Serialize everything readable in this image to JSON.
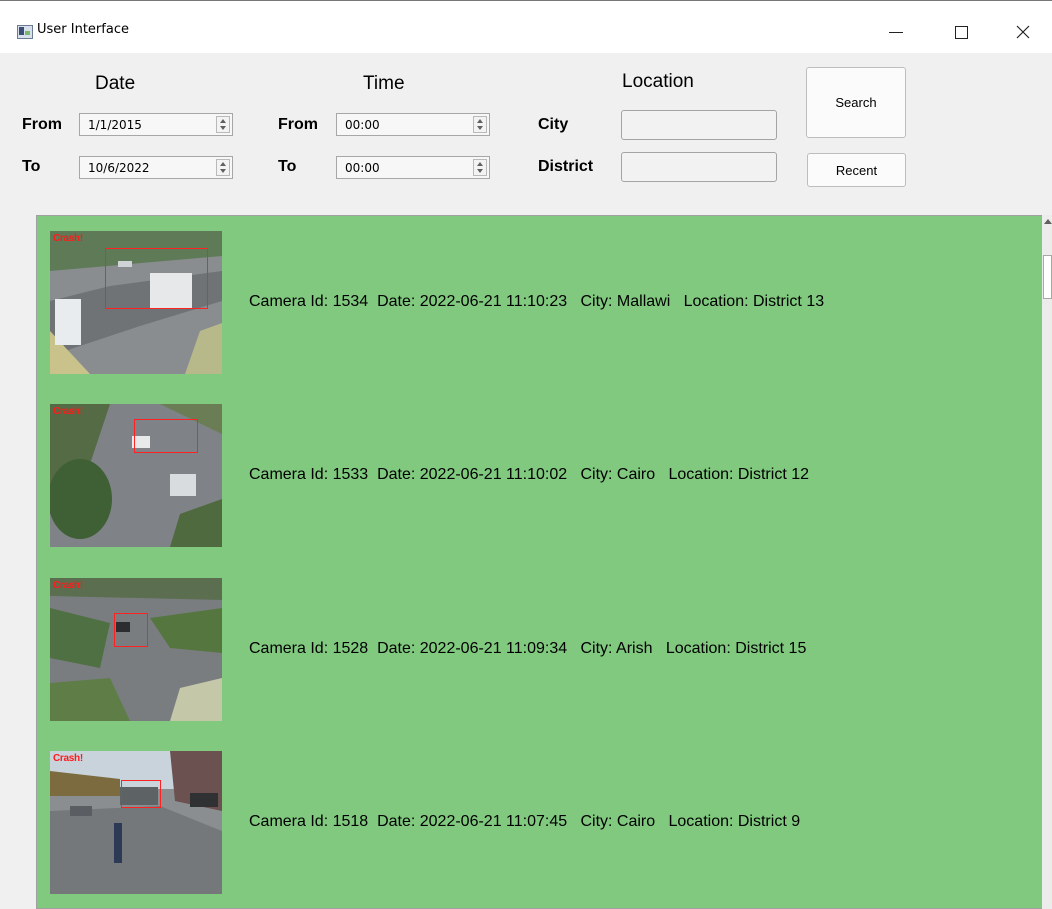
{
  "window": {
    "title": "User Interface",
    "icon": "app-window-icon"
  },
  "filters": {
    "date": {
      "header": "Date",
      "from_label": "From",
      "from_value": "1/1/2015",
      "to_label": "To",
      "to_value": "10/6/2022"
    },
    "time": {
      "header": "Time",
      "from_label": "From",
      "from_value": "00:00",
      "to_label": "To",
      "to_value": "00:00"
    },
    "location": {
      "header": "Location",
      "city_label": "City",
      "city_value": "",
      "district_label": "District",
      "district_value": ""
    },
    "search_label": "Search",
    "recent_label": "Recent"
  },
  "results": [
    {
      "camera_id": "1534",
      "date": "2022-06-21 11:10:23",
      "city": "Mallawi",
      "district": "District 13",
      "text": "Camera Id: 1534  Date: 2022-06-21 11:10:23   City: Mallawi   Location: District 13",
      "overlay": "Crash!"
    },
    {
      "camera_id": "1533",
      "date": "2022-06-21 11:10:02",
      "city": "Cairo",
      "district": "District 12",
      "text": "Camera Id: 1533  Date: 2022-06-21 11:10:02   City: Cairo   Location: District 12",
      "overlay": "Crash!"
    },
    {
      "camera_id": "1528",
      "date": "2022-06-21 11:09:34",
      "city": "Arish",
      "district": "District 15",
      "text": "Camera Id: 1528  Date: 2022-06-21 11:09:34   City: Arish   Location: District 15",
      "overlay": "Crash!"
    },
    {
      "camera_id": "1518",
      "date": "2022-06-21 11:07:45",
      "city": "Cairo",
      "district": "District 9",
      "text": "Camera Id: 1518  Date: 2022-06-21 11:07:45   City: Cairo   Location: District 9",
      "overlay": "Crash!"
    }
  ],
  "colors": {
    "results_background": "#80c97f",
    "crash_overlay": "#ff1a1a"
  }
}
